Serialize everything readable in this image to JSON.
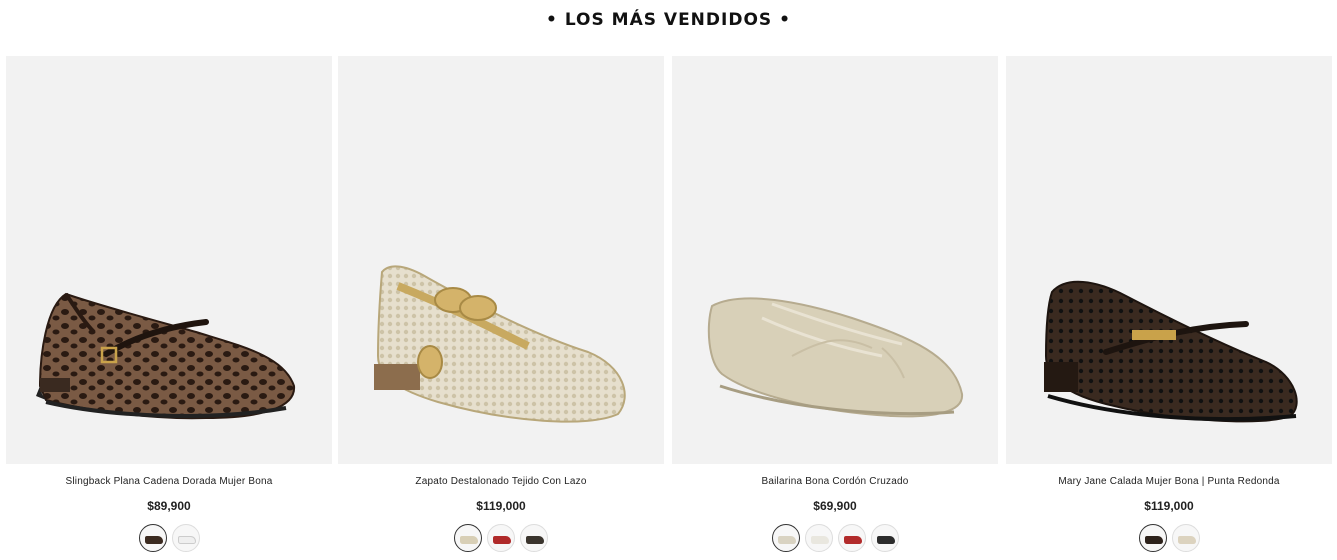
{
  "section": {
    "title": "• LOS MÁS VENDIDOS •"
  },
  "products": [
    {
      "name": "Slingback Plana Cadena Dorada Mujer Bona",
      "price": "$89,900",
      "image_icon": "leopard-mary-jane-flat",
      "swatches": [
        {
          "color": "#3b2a20",
          "active": true
        },
        {
          "color": "#efefef",
          "active": false
        }
      ]
    },
    {
      "name": "Zapato Destalonado Tejido Con Lazo",
      "price": "$119,000",
      "image_icon": "gold-mesh-bow-flat",
      "swatches": [
        {
          "color": "#d8cfb6",
          "active": true
        },
        {
          "color": "#b02a2a",
          "active": false
        },
        {
          "color": "#3a342d",
          "active": false
        }
      ]
    },
    {
      "name": "Bailarina Bona Cordón Cruzado",
      "price": "$69,900",
      "image_icon": "lace-up-ballerina-flat",
      "swatches": [
        {
          "color": "#d9d3c2",
          "active": true
        },
        {
          "color": "#e9e7df",
          "active": false
        },
        {
          "color": "#b22b2b",
          "active": false
        },
        {
          "color": "#2c2c2c",
          "active": false
        }
      ]
    },
    {
      "name": "Mary Jane Calada Mujer Bona | Punta Redonda",
      "price": "$119,000",
      "image_icon": "woven-mary-jane-flat",
      "swatches": [
        {
          "color": "#2d221b",
          "active": true
        },
        {
          "color": "#dcd3bf",
          "active": false
        }
      ]
    }
  ]
}
